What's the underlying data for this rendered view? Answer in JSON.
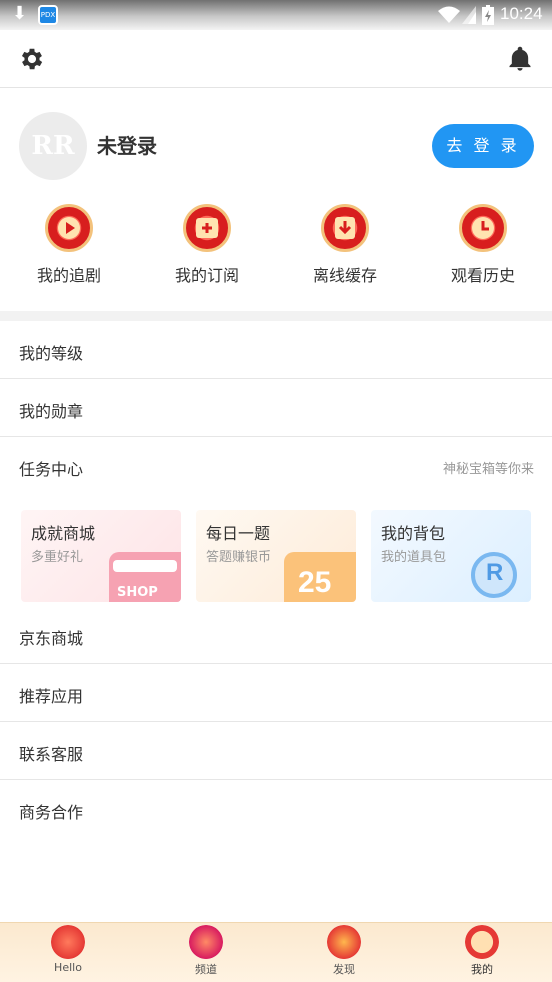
{
  "status_bar": {
    "time": "10:24",
    "app_icon_text": "PDX"
  },
  "profile": {
    "avatar_text": "RR",
    "username": "未登录",
    "login_label": "去 登 录"
  },
  "shortcuts": [
    {
      "label": "我的追剧",
      "icon": "play-icon"
    },
    {
      "label": "我的订阅",
      "icon": "subscribe-icon"
    },
    {
      "label": "离线缓存",
      "icon": "download-icon"
    },
    {
      "label": "观看历史",
      "icon": "clock-icon"
    }
  ],
  "menu": {
    "level": "我的等级",
    "medal": "我的勋章",
    "task_center": "任务中心",
    "task_hint": "神秘宝箱等你来",
    "jd_mall": "京东商城",
    "recommend": "推荐应用",
    "contact": "联系客服",
    "business": "商务合作"
  },
  "cards": [
    {
      "title": "成就商城",
      "subtitle": "多重好礼",
      "deco_text": "SHOP",
      "color": "#fde3e6"
    },
    {
      "title": "每日一题",
      "subtitle": "答题赚银币",
      "deco_text": "25",
      "color": "#fdebd8"
    },
    {
      "title": "我的背包",
      "subtitle": "我的道具包",
      "deco_text": "R",
      "color": "#dcefff"
    }
  ],
  "tabs": [
    {
      "label": "Hello",
      "icon": "hello-2018-icon"
    },
    {
      "label": "频道",
      "icon": "channel-icon"
    },
    {
      "label": "发现",
      "icon": "discover-icon"
    },
    {
      "label": "我的",
      "icon": "mine-icon"
    }
  ]
}
